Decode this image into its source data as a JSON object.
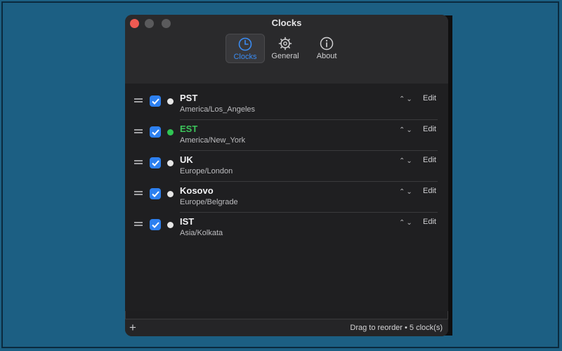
{
  "window": {
    "title": "Clocks"
  },
  "tabs": [
    {
      "label": "Clocks",
      "icon": "clock-icon",
      "active": true
    },
    {
      "label": "General",
      "icon": "gear-icon",
      "active": false
    },
    {
      "label": "About",
      "icon": "info-icon",
      "active": false
    }
  ],
  "clocks": [
    {
      "abbr": "PST",
      "timezone": "America/Los_Angeles",
      "checked": true,
      "dot_color": "#e6e6e6",
      "abbr_color": "#f2f2f4",
      "edit_label": "Edit"
    },
    {
      "abbr": "EST",
      "timezone": "America/New_York",
      "checked": true,
      "dot_color": "#2fc553",
      "abbr_color": "#3cc45a",
      "edit_label": "Edit"
    },
    {
      "abbr": "UK",
      "timezone": "Europe/London",
      "checked": true,
      "dot_color": "#e6e6e6",
      "abbr_color": "#f2f2f4",
      "edit_label": "Edit"
    },
    {
      "abbr": "Kosovo",
      "timezone": "Europe/Belgrade",
      "checked": true,
      "dot_color": "#e6e6e6",
      "abbr_color": "#f2f2f4",
      "edit_label": "Edit"
    },
    {
      "abbr": "IST",
      "timezone": "Asia/Kolkata",
      "checked": true,
      "dot_color": "#e6e6e6",
      "abbr_color": "#f2f2f4",
      "edit_label": "Edit"
    }
  ],
  "footer": {
    "add_label": "+",
    "status": "Drag to reorder • 5 clock(s)"
  },
  "colors": {
    "desktop": "#1c5f83",
    "accent": "#3a8bf2",
    "checkbox": "#2d80f0"
  }
}
